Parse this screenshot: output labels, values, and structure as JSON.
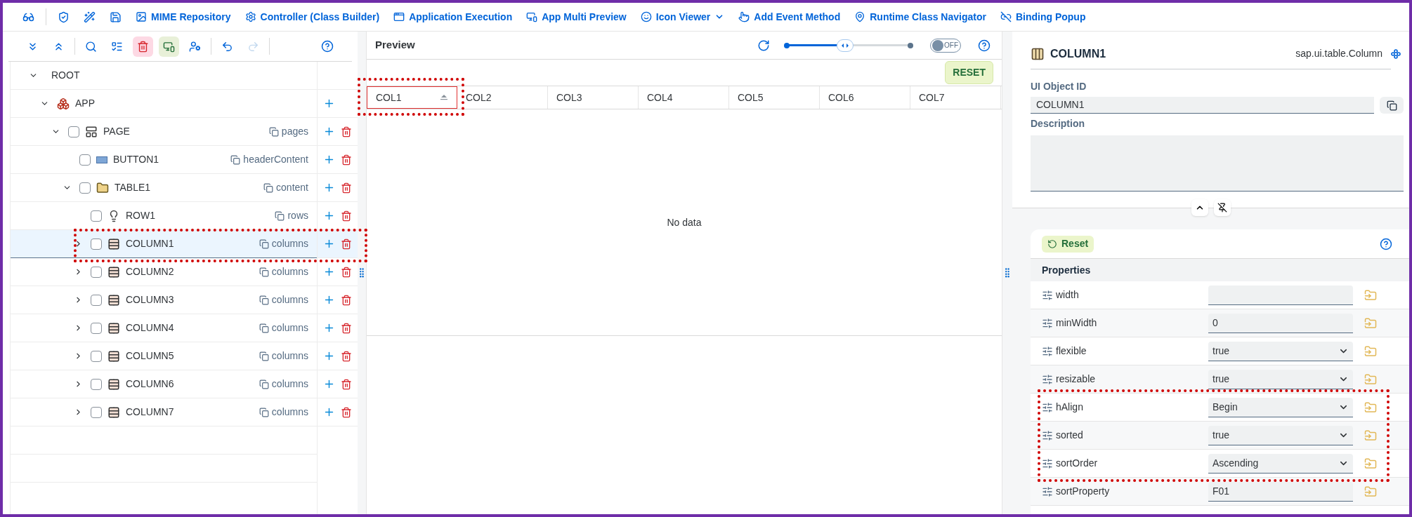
{
  "toolbar": {
    "items": [
      {
        "label": "MIME Repository",
        "kind": "button"
      },
      {
        "label": "Controller (Class Builder)",
        "kind": "button"
      },
      {
        "label": "Application Execution",
        "kind": "button"
      },
      {
        "label": "App Multi Preview",
        "kind": "button"
      },
      {
        "label": "Icon Viewer",
        "kind": "menu"
      },
      {
        "label": "Add Event Method",
        "kind": "button"
      },
      {
        "label": "Runtime Class Navigator",
        "kind": "button"
      },
      {
        "label": "Binding Popup",
        "kind": "button"
      }
    ]
  },
  "tree_toolbar": {
    "redo_disabled": true
  },
  "tree": [
    {
      "label": "ROOT",
      "kind": "root",
      "expanded": true,
      "selected": false,
      "children": [
        {
          "label": "APP",
          "kind": "app",
          "expanded": true,
          "selected": false,
          "children": [
            {
              "label": "PAGE",
              "kind": "page",
              "aggregation": "pages",
              "expanded": true,
              "checked": false,
              "selected": false,
              "children": [
                {
                  "label": "BUTTON1",
                  "kind": "button",
                  "aggregation": "headerContent",
                  "checked": false,
                  "selected": false
                },
                {
                  "label": "TABLE1",
                  "kind": "table",
                  "aggregation": "content",
                  "expanded": true,
                  "checked": false,
                  "selected": false,
                  "children": [
                    {
                      "label": "ROW1",
                      "kind": "row",
                      "aggregation": "rows",
                      "checked": false,
                      "selected": false
                    },
                    {
                      "label": "COLUMN1",
                      "kind": "column",
                      "aggregation": "columns",
                      "expanded": false,
                      "checked": false,
                      "selected": true,
                      "highlighted": true
                    },
                    {
                      "label": "COLUMN2",
                      "kind": "column",
                      "aggregation": "columns",
                      "expanded": false,
                      "checked": false,
                      "selected": false,
                      "highlighted": false
                    },
                    {
                      "label": "COLUMN3",
                      "kind": "column",
                      "aggregation": "columns",
                      "expanded": false,
                      "checked": false,
                      "selected": false,
                      "highlighted": false
                    },
                    {
                      "label": "COLUMN4",
                      "kind": "column",
                      "aggregation": "columns",
                      "expanded": false,
                      "checked": false,
                      "selected": false,
                      "highlighted": false
                    },
                    {
                      "label": "COLUMN5",
                      "kind": "column",
                      "aggregation": "columns",
                      "expanded": false,
                      "checked": false,
                      "selected": false,
                      "highlighted": false
                    },
                    {
                      "label": "COLUMN6",
                      "kind": "column",
                      "aggregation": "columns",
                      "expanded": false,
                      "checked": false,
                      "selected": false,
                      "highlighted": false
                    },
                    {
                      "label": "COLUMN7",
                      "kind": "column",
                      "aggregation": "columns",
                      "expanded": false,
                      "checked": false,
                      "selected": false,
                      "highlighted": false
                    }
                  ]
                }
              ]
            }
          ]
        }
      ]
    }
  ],
  "preview": {
    "title": "Preview",
    "zoom": {
      "level": 0.47
    },
    "toggle": {
      "label": "OFF",
      "on": false
    },
    "reset": "RESET",
    "empty_text": "No data",
    "columns": [
      {
        "label": "COL1",
        "selected": true,
        "sorted": true,
        "highlighted": true
      },
      {
        "label": "COL2",
        "selected": false,
        "sorted": false,
        "highlighted": false
      },
      {
        "label": "COL3",
        "selected": false,
        "sorted": false,
        "highlighted": false
      },
      {
        "label": "COL4",
        "selected": false,
        "sorted": false,
        "highlighted": false
      },
      {
        "label": "COL5",
        "selected": false,
        "sorted": false,
        "highlighted": false
      },
      {
        "label": "COL6",
        "selected": false,
        "sorted": false,
        "highlighted": false
      },
      {
        "label": "COL7",
        "selected": false,
        "sorted": false,
        "highlighted": false
      }
    ]
  },
  "details": {
    "title": "COLUMN1",
    "class_name": "sap.ui.table.Column",
    "id_label": "UI Object ID",
    "id_value": "COLUMN1",
    "description_label": "Description"
  },
  "properties_panel": {
    "reset": "Reset",
    "title": "Properties",
    "rows": [
      {
        "name": "width",
        "kind": "input",
        "highlighted": false
      },
      {
        "name": "minWidth",
        "kind": "input",
        "value": "0",
        "highlighted": false
      },
      {
        "name": "flexible",
        "kind": "select",
        "value": "true",
        "highlighted": false
      },
      {
        "name": "resizable",
        "kind": "select",
        "value": "true",
        "highlighted": false
      },
      {
        "name": "hAlign",
        "kind": "select",
        "value": "Begin",
        "highlighted": true
      },
      {
        "name": "sorted",
        "kind": "select",
        "value": "true",
        "highlighted": true
      },
      {
        "name": "sortOrder",
        "kind": "select",
        "value": "Ascending",
        "highlighted": true
      },
      {
        "name": "sortProperty",
        "kind": "input",
        "value": "F01",
        "highlighted": false
      }
    ]
  }
}
